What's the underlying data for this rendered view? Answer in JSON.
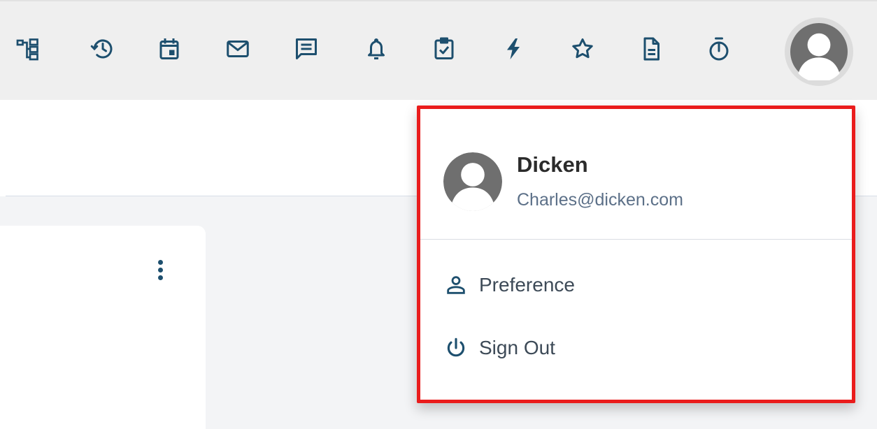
{
  "toolbar": {
    "icons": [
      {
        "name": "hierarchy-icon"
      },
      {
        "name": "history-icon"
      },
      {
        "name": "calendar-icon"
      },
      {
        "name": "mail-icon"
      },
      {
        "name": "chat-icon"
      },
      {
        "name": "bell-icon"
      },
      {
        "name": "task-icon"
      },
      {
        "name": "lightning-icon"
      },
      {
        "name": "star-icon"
      },
      {
        "name": "document-icon"
      },
      {
        "name": "timer-icon"
      }
    ],
    "icon_color": "#1d4f6e"
  },
  "user_menu": {
    "name": "Dicken",
    "email": "Charles@dicken.com",
    "items": [
      {
        "label": "Preference",
        "icon": "user-icon"
      },
      {
        "label": "Sign Out",
        "icon": "power-icon"
      }
    ],
    "highlight_color": "#ea1c1c"
  }
}
